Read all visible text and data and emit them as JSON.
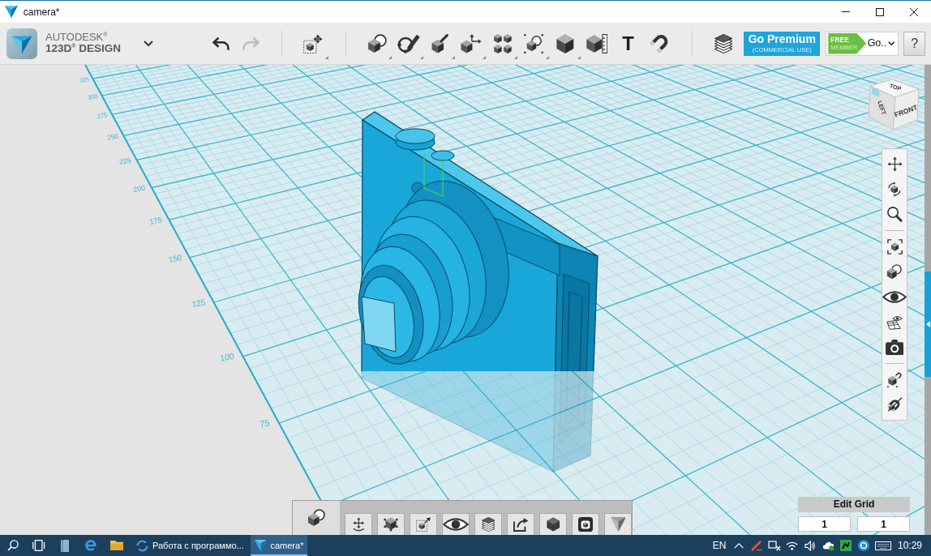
{
  "window": {
    "title": "camera*"
  },
  "header": {
    "brand_top": "AUTODESK$^{®}$",
    "brand_bottom": "123D$^{®}$ DESIGN"
  },
  "history": [
    {
      "kind": "undo",
      "disabled": false
    },
    {
      "kind": "redo",
      "disabled": true
    }
  ],
  "tools": [
    {
      "kind": "separator"
    },
    {
      "kind": "transform",
      "dropdown": true
    },
    {
      "kind": "separator"
    },
    {
      "kind": "primitives",
      "dropdown": true
    },
    {
      "kind": "sketch",
      "dropdown": true
    },
    {
      "kind": "construct",
      "dropdown": true
    },
    {
      "kind": "modify",
      "dropdown": true
    },
    {
      "kind": "pattern",
      "dropdown": true
    },
    {
      "kind": "grouping",
      "dropdown": true
    },
    {
      "kind": "combine",
      "dropdown": true
    },
    {
      "kind": "measure",
      "dropdown": false
    },
    {
      "kind": "text",
      "label": "T",
      "dropdown": false
    },
    {
      "kind": "snap",
      "dropdown": false
    },
    {
      "kind": "separator"
    },
    {
      "kind": "material",
      "dropdown": false
    }
  ],
  "premium": {
    "title": "Go Premium",
    "subtitle": "(COMMERCIAL USE)"
  },
  "account": {
    "tag_top": "FREE",
    "tag_bottom": "MEMBER",
    "label": "Go.."
  },
  "help": {
    "label": "?"
  },
  "viewport": {
    "ruler_labels": [
      "325",
      "300",
      "275",
      "250",
      "225",
      "200",
      "175",
      "150",
      "125",
      "100",
      "75"
    ],
    "view_cube": {
      "top": "TOP",
      "left": "LEFT",
      "front": "FRONT"
    }
  },
  "nav_tools": [
    {
      "kind": "pan"
    },
    {
      "kind": "orbit"
    },
    {
      "kind": "zoom"
    },
    {
      "kind": "separator"
    },
    {
      "kind": "fit"
    },
    {
      "kind": "shading"
    },
    {
      "kind": "visibility"
    },
    {
      "kind": "gridview"
    },
    {
      "kind": "camera"
    },
    {
      "kind": "separator"
    },
    {
      "kind": "snapview"
    },
    {
      "kind": "hide"
    }
  ],
  "bottom_tools": [
    {
      "kind": "shapes"
    },
    {
      "kind": "move"
    },
    {
      "kind": "nodes"
    },
    {
      "kind": "scale"
    },
    {
      "kind": "visibility"
    },
    {
      "kind": "layers"
    },
    {
      "kind": "export"
    },
    {
      "kind": "material"
    },
    {
      "kind": "snapshot"
    },
    {
      "kind": "logo"
    }
  ],
  "edit_grid": {
    "title": "Edit Grid",
    "fields": [
      {
        "value": "1"
      },
      {
        "value": "1"
      }
    ]
  },
  "taskbar": {
    "pinned": [
      {
        "kind": "search"
      },
      {
        "kind": "taskview"
      },
      {
        "kind": "notes"
      },
      {
        "kind": "browser"
      },
      {
        "kind": "files"
      }
    ],
    "tasks": [
      {
        "kind": "web",
        "label": "Работа с программо...",
        "selected": false
      },
      {
        "kind": "design",
        "label": "camera*",
        "selected": true
      }
    ],
    "language": "EN",
    "tray": [
      {
        "kind": "overflow"
      },
      {
        "kind": "alert"
      },
      {
        "kind": "network"
      },
      {
        "kind": "wifi"
      },
      {
        "kind": "volume"
      },
      {
        "kind": "cloud"
      },
      {
        "kind": "app"
      },
      {
        "kind": "messenger"
      },
      {
        "kind": "keyboard"
      }
    ],
    "clock": "10:29"
  }
}
